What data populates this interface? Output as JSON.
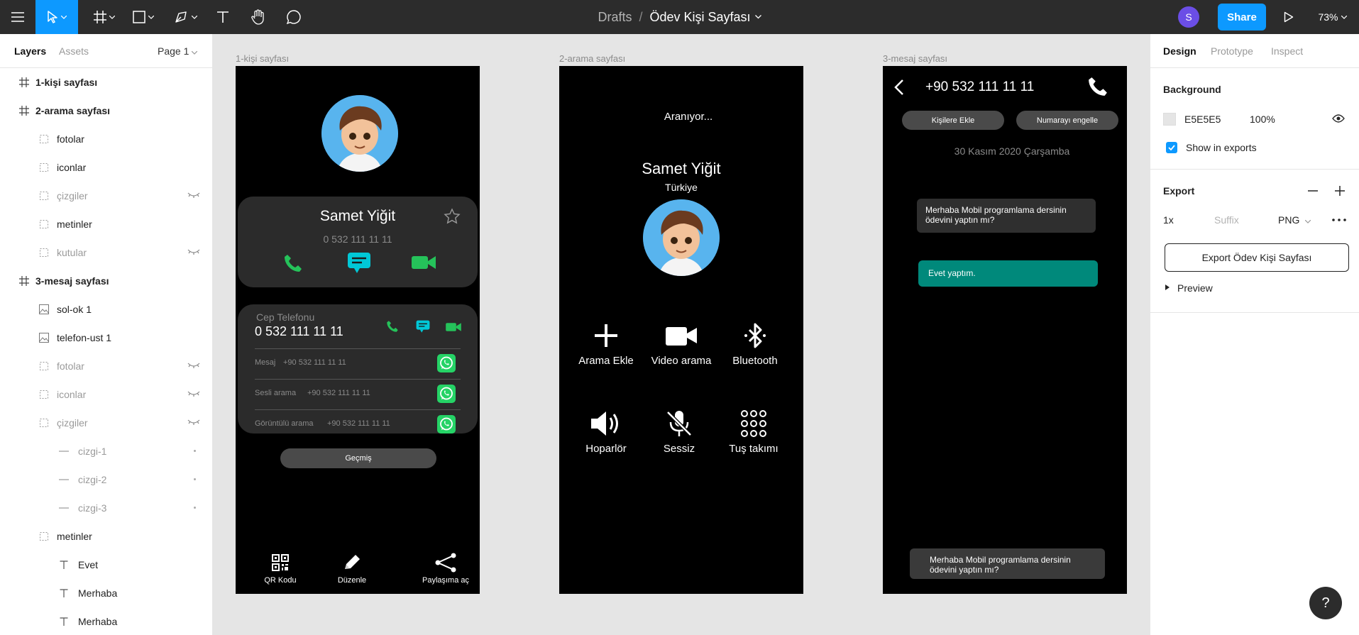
{
  "topbar": {
    "breadcrumb_drafts": "Drafts",
    "breadcrumb_sep": "/",
    "file_name": "Ödev Kişi Sayfası",
    "avatar_initial": "S",
    "share_label": "Share",
    "zoom": "73%"
  },
  "layers_panel": {
    "tab_layers": "Layers",
    "tab_assets": "Assets",
    "page": "Page 1",
    "items": [
      {
        "label": "1-kişi sayfası",
        "type": "frame",
        "depth": 0
      },
      {
        "label": "2-arama sayfası",
        "type": "frame",
        "depth": 0
      },
      {
        "label": "fotolar",
        "type": "group",
        "depth": 1
      },
      {
        "label": "iconlar",
        "type": "group",
        "depth": 1
      },
      {
        "label": "çizgiler",
        "type": "group",
        "depth": 1,
        "hidden": true
      },
      {
        "label": "metinler",
        "type": "group",
        "depth": 1
      },
      {
        "label": "kutular",
        "type": "group",
        "depth": 1,
        "hidden": true
      },
      {
        "label": "3-mesaj sayfası",
        "type": "frame",
        "depth": 0
      },
      {
        "label": "sol-ok 1",
        "type": "image",
        "depth": 1
      },
      {
        "label": "telefon-ust 1",
        "type": "image",
        "depth": 1
      },
      {
        "label": "fotolar",
        "type": "group",
        "depth": 1,
        "hidden": true
      },
      {
        "label": "iconlar",
        "type": "group",
        "depth": 1,
        "hidden": true
      },
      {
        "label": "çizgiler",
        "type": "group",
        "depth": 1,
        "hidden": true
      },
      {
        "label": "cizgi-1",
        "type": "line",
        "depth": 2,
        "hidden": true
      },
      {
        "label": "cizgi-2",
        "type": "line",
        "depth": 2,
        "hidden": true
      },
      {
        "label": "cizgi-3",
        "type": "line",
        "depth": 2,
        "hidden": true
      },
      {
        "label": "metinler",
        "type": "group",
        "depth": 1
      },
      {
        "label": "Evet",
        "type": "text",
        "depth": 2
      },
      {
        "label": "Merhaba",
        "type": "text",
        "depth": 2
      },
      {
        "label": "Merhaba",
        "type": "text",
        "depth": 2
      }
    ]
  },
  "canvas": {
    "frame1": {
      "label": "1-kişi sayfası",
      "name": "Samet Yiğit",
      "phone": "0 532 111 11 11",
      "cep_label": "Cep Telefonu",
      "cep_number": "0 532 111 11 11",
      "rows": [
        {
          "label": "Mesaj",
          "number": "+90 532 111 11 11"
        },
        {
          "label": "Sesli arama",
          "number": "+90 532 111 11 11"
        },
        {
          "label": "Görüntülü arama",
          "number": "+90 532 111 11 11"
        }
      ],
      "history_button": "Geçmiş",
      "bottom": {
        "qr": "QR Kodu",
        "edit": "Düzenle",
        "share": "Paylaşıma aç"
      }
    },
    "frame2": {
      "label": "2-arama sayfası",
      "status": "Aranıyor...",
      "name": "Samet Yiğit",
      "country": "Türkiye",
      "actions": [
        "Arama Ekle",
        "Video arama",
        "Bluetooth",
        "Hoparlör",
        "Sessiz",
        "Tuş takımı"
      ]
    },
    "frame3": {
      "label": "3-mesaj sayfası",
      "number": "+90 532 111 11 11",
      "add_contact": "Kişilere Ekle",
      "block_number": "Numarayı engelle",
      "date": "30 Kasım 2020 Çarşamba",
      "msg_in": "Merhaba Mobil programlama dersinin ödevini yaptın mı?",
      "msg_out": "Evet yaptım.",
      "input_msg": "Merhaba Mobil programlama dersinin ödevini yaptın mı?"
    }
  },
  "design_panel": {
    "tab_design": "Design",
    "tab_prototype": "Prototype",
    "tab_inspect": "Inspect",
    "background_title": "Background",
    "bg_hex": "E5E5E5",
    "bg_opacity": "100%",
    "show_in_exports": "Show in exports",
    "export_title": "Export",
    "scale": "1x",
    "suffix_placeholder": "Suffix",
    "format": "PNG",
    "export_button": "Export Ödev Kişi Sayfası",
    "preview": "Preview"
  },
  "help_label": "?",
  "colors": {
    "toolbar": "#2c2c2c",
    "active_tool": "#0d99ff",
    "share": "#0d99ff",
    "avatar": "#6b4ee6",
    "green": "#25c25a",
    "teal": "#00c8d7",
    "bubble_out": "#00897b",
    "whatsapp": "#25d366"
  }
}
